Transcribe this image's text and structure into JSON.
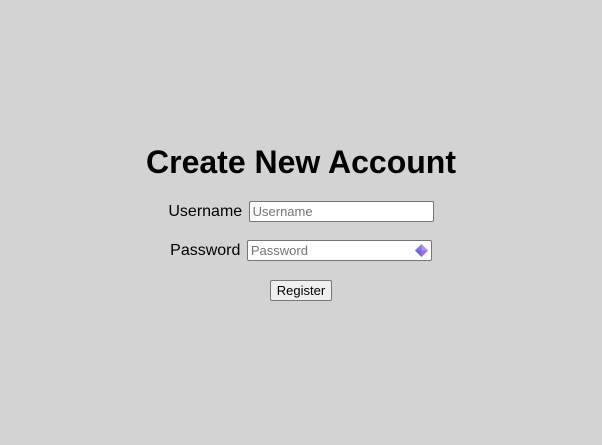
{
  "title": "Create New Account",
  "form": {
    "username": {
      "label": "Username",
      "placeholder": "Username",
      "value": ""
    },
    "password": {
      "label": "Password",
      "placeholder": "Password",
      "value": ""
    },
    "submit_label": "Register"
  },
  "icons": {
    "password_manager": "password-manager-icon"
  },
  "colors": {
    "background": "#d3d3d3",
    "icon_gradient_start": "#5b7cfa",
    "icon_gradient_end": "#c06bd6"
  }
}
